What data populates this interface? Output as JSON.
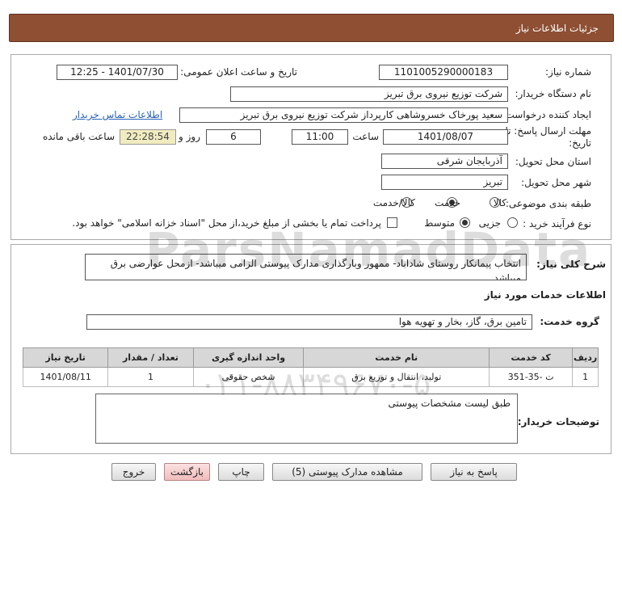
{
  "header": {
    "title": "جزئیات اطلاعات نیاز"
  },
  "fields": {
    "need_number_label": "شماره نیاز:",
    "need_number": "1101005290000183",
    "announce_datetime_label": "تاریخ و ساعت اعلان عمومی:",
    "announce_datetime": "1401/07/30 - 12:25",
    "buyer_org_label": "نام دستگاه خریدار:",
    "buyer_org": "شرکت توزیع نیروی برق تبریز",
    "requester_label": "ایجاد کننده درخواست:",
    "requester": "سعید پورخاک خسروشاهی کارپرداز شرکت توزیع نیروی برق تبریز",
    "contact_link": "اطلاعات تماس خریدار",
    "deadline_label_line1": "مهلت ارسال پاسخ: تا",
    "deadline_label_line2": "تاریخ:",
    "deadline_date": "1401/08/07",
    "time_label": "ساعت",
    "deadline_time": "11:00",
    "days_value": "6",
    "days_label": "روز و",
    "remaining_time": "22:28:54",
    "remaining_label": "ساعت باقی مانده",
    "province_label": "استان محل تحویل:",
    "province": "آذربایجان شرقی",
    "city_label": "شهر محل تحویل:",
    "city": "تبریز",
    "category_label": "طبقه بندی موضوعی:",
    "category_options": [
      "کالا",
      "خدمت",
      "کالا/خدمت"
    ],
    "category_selected": "خدمت",
    "process_label": "نوع فرآیند خرید :",
    "process_options": [
      "جزیی",
      "متوسط"
    ],
    "process_selected": "متوسط",
    "payment_note": "پرداخت تمام یا بخشی از مبلغ خرید،از محل \"اسناد خزانه اسلامی\" خواهد بود."
  },
  "summary": {
    "label": "شرح کلی نیاز:",
    "text": "انتخاب پیمانکار روستای شاداباد- ممهور وبارگذاری مدارک پیوستی الزامی میباشد- ازمحل عوارضی برق میباشد"
  },
  "services": {
    "section_title": "اطلاعات خدمات مورد نیاز",
    "group_label": "گروه خدمت:",
    "group_value": "تامین برق، گاز، بخار و تهویه هوا",
    "columns": [
      "ردیف",
      "کد خدمت",
      "نام خدمت",
      "واحد اندازه گیری",
      "تعداد / مقدار",
      "تاریخ نیاز"
    ],
    "rows": [
      [
        "1",
        "ت -35-351",
        "تولید، انتقال و توزیع برق",
        "شخص حقوقی",
        "1",
        "1401/08/11"
      ]
    ]
  },
  "buyer_notes": {
    "label": "توضیحات خریدار:",
    "text": "طبق لیست مشخصات پیوستی"
  },
  "buttons": {
    "reply": "پاسخ به نیاز",
    "attachments": "مشاهده مدارک پیوستی (5)",
    "print": "چاپ",
    "back": "بازگشت",
    "exit": "خروج"
  },
  "watermark": {
    "line1": "ParsNamadData",
    "line2": "۰۲۱-۸۸۳۴۹۶۷۰-۵"
  },
  "colors": {
    "header": "#8e4f33",
    "link": "#2a63b8",
    "remaining_bg": "#f1ecc0",
    "table_head": "#d7d7d7"
  }
}
